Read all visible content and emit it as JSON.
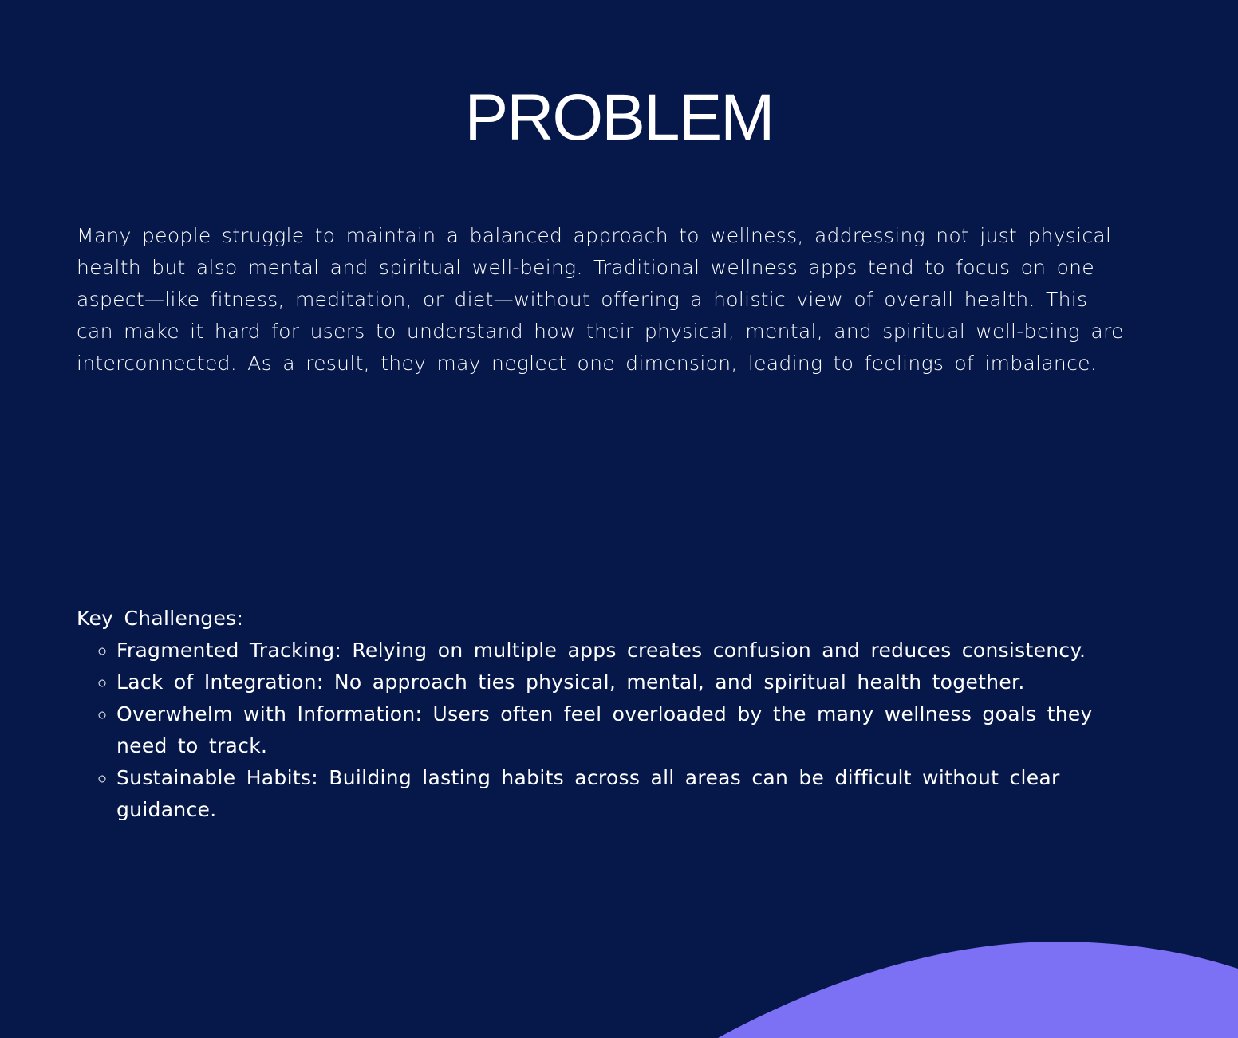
{
  "title": "PROBLEM",
  "intro": "Many people struggle to maintain a balanced approach to wellness, addressing not just physical health but also mental and spiritual well-being. Traditional wellness apps tend to focus on one aspect—like fitness, meditation, or diet—without offering a holistic view of overall health. This can make it hard for users to understand how their physical, mental, and spiritual well-being are interconnected. As a result, they may neglect one dimension, leading to feelings of imbalance.",
  "challenges": {
    "heading": "Key Challenges:",
    "items": [
      "Fragmented Tracking: Relying on multiple apps creates confusion and reduces consistency.",
      "Lack of Integration: No approach ties physical, mental, and spiritual health together.",
      "Overwhelm with Information: Users often feel overloaded by the many wellness goals they need to track.",
      "Sustainable Habits: Building lasting habits across all areas can be difficult without clear guidance."
    ]
  },
  "colors": {
    "background": "#061749",
    "accent": "#7c70f5",
    "text": "#ffffff"
  }
}
